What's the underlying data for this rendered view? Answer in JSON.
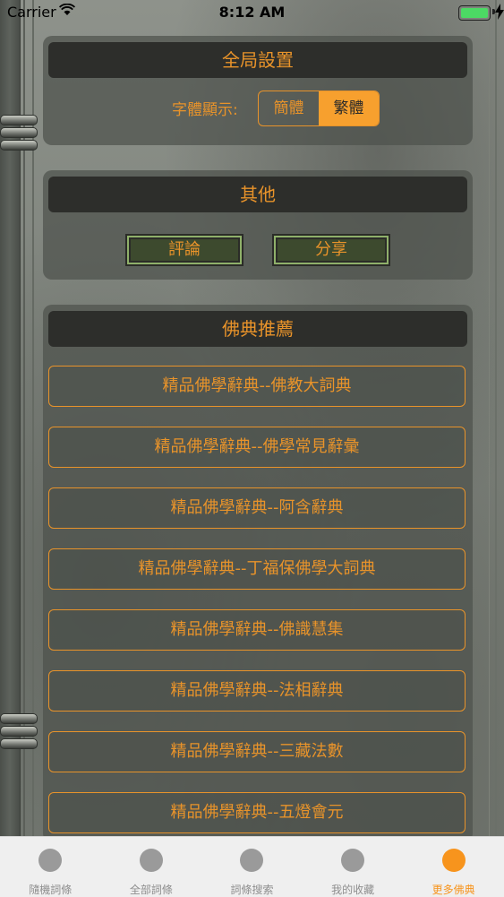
{
  "status_bar": {
    "carrier": "Carrier",
    "time": "8:12 AM"
  },
  "global_settings": {
    "title": "全局設置",
    "font_label": "字體顯示:",
    "simplified": "簡體",
    "traditional": "繁體",
    "selected": "traditional"
  },
  "others": {
    "title": "其他",
    "review": "評論",
    "share": "分享"
  },
  "recommend": {
    "title": "佛典推薦",
    "items": [
      "精品佛學辭典--佛教大詞典",
      "精品佛學辭典--佛學常見辭彙",
      "精品佛學辭典--阿含辭典",
      "精品佛學辭典--丁福保佛學大詞典",
      "精品佛學辭典--佛識慧集",
      "精品佛學辭典--法相辭典",
      "精品佛學辭典--三藏法數",
      "精品佛學辭典--五燈會元"
    ]
  },
  "tabs": [
    {
      "label": "隨機詞條"
    },
    {
      "label": "全部詞條"
    },
    {
      "label": "詞條搜索"
    },
    {
      "label": "我的收藏"
    },
    {
      "label": "更多佛典"
    }
  ],
  "colors": {
    "accent": "#e8932a",
    "active_tab": "#f7941d"
  }
}
